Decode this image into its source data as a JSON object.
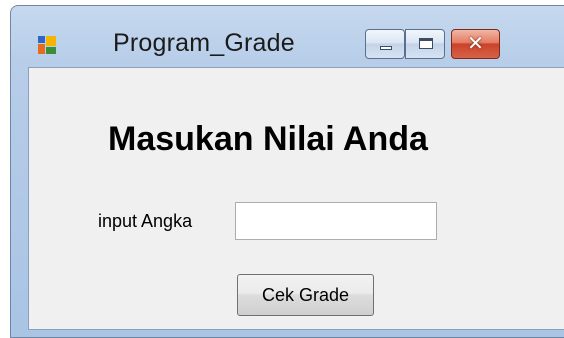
{
  "window": {
    "title": "Program_Grade",
    "icon": "app-window-icon"
  },
  "caption_buttons": {
    "minimize_icon": "minimize-icon",
    "maximize_icon": "maximize-icon",
    "close_glyph": "✕"
  },
  "form": {
    "heading": "Masukan Nilai Anda",
    "input_label": "input Angka",
    "input_value": "",
    "button_label": "Cek Grade"
  },
  "colors": {
    "frame": "#b7cde8",
    "close_button": "#c9432a",
    "client_background": "#f0f0f0"
  }
}
